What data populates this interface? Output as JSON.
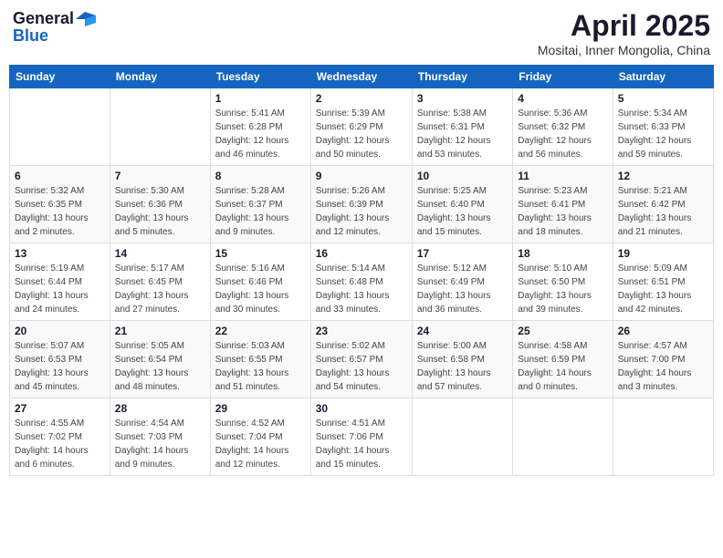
{
  "header": {
    "logo_general": "General",
    "logo_blue": "Blue",
    "month": "April 2025",
    "location": "Mositai, Inner Mongolia, China"
  },
  "days_of_week": [
    "Sunday",
    "Monday",
    "Tuesday",
    "Wednesday",
    "Thursday",
    "Friday",
    "Saturday"
  ],
  "weeks": [
    [
      {
        "day": "",
        "detail": ""
      },
      {
        "day": "",
        "detail": ""
      },
      {
        "day": "1",
        "detail": "Sunrise: 5:41 AM\nSunset: 6:28 PM\nDaylight: 12 hours\nand 46 minutes."
      },
      {
        "day": "2",
        "detail": "Sunrise: 5:39 AM\nSunset: 6:29 PM\nDaylight: 12 hours\nand 50 minutes."
      },
      {
        "day": "3",
        "detail": "Sunrise: 5:38 AM\nSunset: 6:31 PM\nDaylight: 12 hours\nand 53 minutes."
      },
      {
        "day": "4",
        "detail": "Sunrise: 5:36 AM\nSunset: 6:32 PM\nDaylight: 12 hours\nand 56 minutes."
      },
      {
        "day": "5",
        "detail": "Sunrise: 5:34 AM\nSunset: 6:33 PM\nDaylight: 12 hours\nand 59 minutes."
      }
    ],
    [
      {
        "day": "6",
        "detail": "Sunrise: 5:32 AM\nSunset: 6:35 PM\nDaylight: 13 hours\nand 2 minutes."
      },
      {
        "day": "7",
        "detail": "Sunrise: 5:30 AM\nSunset: 6:36 PM\nDaylight: 13 hours\nand 5 minutes."
      },
      {
        "day": "8",
        "detail": "Sunrise: 5:28 AM\nSunset: 6:37 PM\nDaylight: 13 hours\nand 9 minutes."
      },
      {
        "day": "9",
        "detail": "Sunrise: 5:26 AM\nSunset: 6:39 PM\nDaylight: 13 hours\nand 12 minutes."
      },
      {
        "day": "10",
        "detail": "Sunrise: 5:25 AM\nSunset: 6:40 PM\nDaylight: 13 hours\nand 15 minutes."
      },
      {
        "day": "11",
        "detail": "Sunrise: 5:23 AM\nSunset: 6:41 PM\nDaylight: 13 hours\nand 18 minutes."
      },
      {
        "day": "12",
        "detail": "Sunrise: 5:21 AM\nSunset: 6:42 PM\nDaylight: 13 hours\nand 21 minutes."
      }
    ],
    [
      {
        "day": "13",
        "detail": "Sunrise: 5:19 AM\nSunset: 6:44 PM\nDaylight: 13 hours\nand 24 minutes."
      },
      {
        "day": "14",
        "detail": "Sunrise: 5:17 AM\nSunset: 6:45 PM\nDaylight: 13 hours\nand 27 minutes."
      },
      {
        "day": "15",
        "detail": "Sunrise: 5:16 AM\nSunset: 6:46 PM\nDaylight: 13 hours\nand 30 minutes."
      },
      {
        "day": "16",
        "detail": "Sunrise: 5:14 AM\nSunset: 6:48 PM\nDaylight: 13 hours\nand 33 minutes."
      },
      {
        "day": "17",
        "detail": "Sunrise: 5:12 AM\nSunset: 6:49 PM\nDaylight: 13 hours\nand 36 minutes."
      },
      {
        "day": "18",
        "detail": "Sunrise: 5:10 AM\nSunset: 6:50 PM\nDaylight: 13 hours\nand 39 minutes."
      },
      {
        "day": "19",
        "detail": "Sunrise: 5:09 AM\nSunset: 6:51 PM\nDaylight: 13 hours\nand 42 minutes."
      }
    ],
    [
      {
        "day": "20",
        "detail": "Sunrise: 5:07 AM\nSunset: 6:53 PM\nDaylight: 13 hours\nand 45 minutes."
      },
      {
        "day": "21",
        "detail": "Sunrise: 5:05 AM\nSunset: 6:54 PM\nDaylight: 13 hours\nand 48 minutes."
      },
      {
        "day": "22",
        "detail": "Sunrise: 5:03 AM\nSunset: 6:55 PM\nDaylight: 13 hours\nand 51 minutes."
      },
      {
        "day": "23",
        "detail": "Sunrise: 5:02 AM\nSunset: 6:57 PM\nDaylight: 13 hours\nand 54 minutes."
      },
      {
        "day": "24",
        "detail": "Sunrise: 5:00 AM\nSunset: 6:58 PM\nDaylight: 13 hours\nand 57 minutes."
      },
      {
        "day": "25",
        "detail": "Sunrise: 4:58 AM\nSunset: 6:59 PM\nDaylight: 14 hours\nand 0 minutes."
      },
      {
        "day": "26",
        "detail": "Sunrise: 4:57 AM\nSunset: 7:00 PM\nDaylight: 14 hours\nand 3 minutes."
      }
    ],
    [
      {
        "day": "27",
        "detail": "Sunrise: 4:55 AM\nSunset: 7:02 PM\nDaylight: 14 hours\nand 6 minutes."
      },
      {
        "day": "28",
        "detail": "Sunrise: 4:54 AM\nSunset: 7:03 PM\nDaylight: 14 hours\nand 9 minutes."
      },
      {
        "day": "29",
        "detail": "Sunrise: 4:52 AM\nSunset: 7:04 PM\nDaylight: 14 hours\nand 12 minutes."
      },
      {
        "day": "30",
        "detail": "Sunrise: 4:51 AM\nSunset: 7:06 PM\nDaylight: 14 hours\nand 15 minutes."
      },
      {
        "day": "",
        "detail": ""
      },
      {
        "day": "",
        "detail": ""
      },
      {
        "day": "",
        "detail": ""
      }
    ]
  ]
}
